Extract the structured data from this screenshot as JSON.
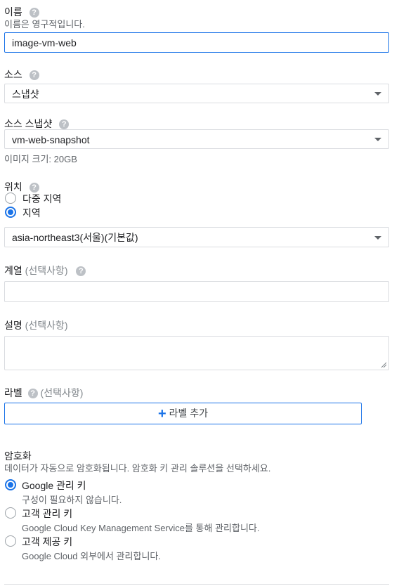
{
  "name": {
    "label": "이름",
    "hint": "이름은 영구적입니다.",
    "value": "image-vm-web"
  },
  "source": {
    "label": "소스",
    "selected": "스냅샷"
  },
  "source_snapshot": {
    "label": "소스 스냅샷",
    "selected": "vm-web-snapshot",
    "size_hint": "이미지 크기: 20GB"
  },
  "location": {
    "label": "위치",
    "options": [
      "다중 지역",
      "지역"
    ],
    "selected_index": 1,
    "region_selected": "asia-northeast3(서울)(기본값)"
  },
  "family": {
    "label": "계열",
    "optional": "(선택사항)",
    "value": ""
  },
  "description": {
    "label": "설명",
    "optional": "(선택사항)",
    "value": ""
  },
  "labels": {
    "label": "라벨",
    "optional": "(선택사항)",
    "add_button": "라벨 추가"
  },
  "encryption": {
    "label": "암호화",
    "hint": "데이터가 자동으로 암호화됩니다. 암호화 키 관리 솔루션을 선택하세요.",
    "options": [
      {
        "title": "Google 관리 키",
        "desc": "구성이 필요하지 않습니다."
      },
      {
        "title": "고객 관리 키",
        "desc": "Google Cloud Key Management Service를 통해 관리합니다."
      },
      {
        "title": "고객 제공 키",
        "desc": "Google Cloud 외부에서 관리합니다."
      }
    ],
    "selected_index": 0
  },
  "icons": {
    "help": "question-mark",
    "dropdown": "triangle-down",
    "add": "plus"
  },
  "colors": {
    "accent": "#1a73e8",
    "text": "#202124",
    "muted": "#5f6368",
    "border": "#dadce0"
  }
}
